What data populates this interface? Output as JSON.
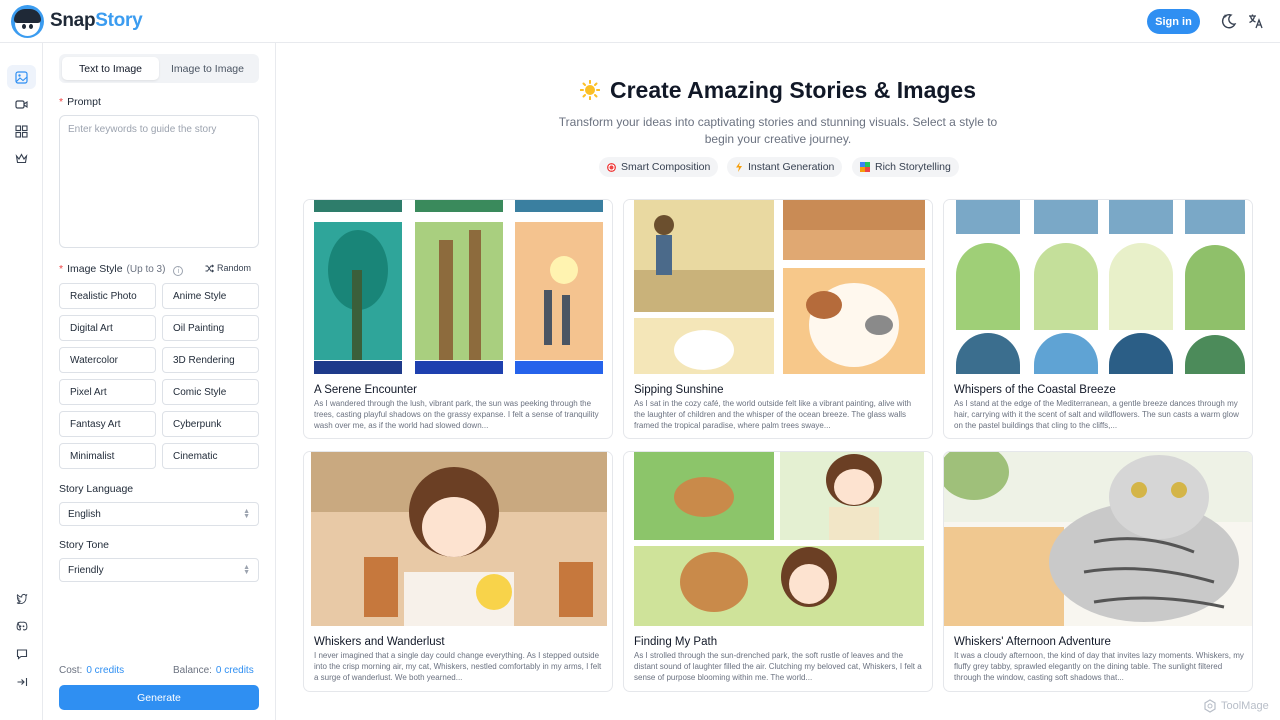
{
  "app": {
    "name_part1": "Snap",
    "name_part2": "Story"
  },
  "header": {
    "signin_label": "Sign in"
  },
  "panel": {
    "tabs": [
      "Text to Image",
      "Image to Image"
    ],
    "prompt_label": "Prompt",
    "prompt_placeholder": "Enter keywords to guide the story",
    "image_style_label": "Image Style",
    "image_style_hint": "(Up to 3)",
    "random_label": "Random",
    "styles": [
      "Realistic Photo",
      "Anime Style",
      "Digital Art",
      "Oil Painting",
      "Watercolor",
      "3D Rendering",
      "Pixel Art",
      "Comic Style",
      "Fantasy Art",
      "Cyberpunk",
      "Minimalist",
      "Cinematic"
    ],
    "language_label": "Story Language",
    "language_value": "English",
    "tone_label": "Story Tone",
    "tone_value": "Friendly",
    "cost_label": "Cost:",
    "cost_value": "0 credits",
    "balance_label": "Balance:",
    "balance_value": "0 credits",
    "generate_label": "Generate"
  },
  "main": {
    "title": "Create Amazing Stories & Images",
    "subtitle": "Transform your ideas into captivating stories and stunning visuals. Select a style to begin your creative journey.",
    "features": [
      "Smart Composition",
      "Instant Generation",
      "Rich Storytelling"
    ],
    "cards": [
      {
        "title": "A Serene Encounter",
        "text": "As I wandered through the lush, vibrant park, the sun was peeking through the trees, casting playful shadows on the grassy expanse. I felt a sense of tranquility wash over me, as if the world had slowed down..."
      },
      {
        "title": "Sipping Sunshine",
        "text": "As I sat in the cozy café, the world outside felt like a vibrant painting, alive with the laughter of children and the whisper of the ocean breeze. The glass walls framed the tropical paradise, where palm trees swaye..."
      },
      {
        "title": "Whispers of the Coastal Breeze",
        "text": "As I stand at the edge of the Mediterranean, a gentle breeze dances through my hair, carrying with it the scent of salt and wildflowers. The sun casts a warm glow on the pastel buildings that cling to the cliffs,..."
      },
      {
        "title": "Whiskers and Wanderlust",
        "text": "I never imagined that a single day could change everything. As I stepped outside into the crisp morning air, my cat, Whiskers, nestled comfortably in my arms, I felt a surge of wanderlust. We both yearned..."
      },
      {
        "title": "Finding My Path",
        "text": "As I strolled through the sun-drenched park, the soft rustle of leaves and the distant sound of laughter filled the air. Clutching my beloved cat, Whiskers, I felt a sense of purpose blooming within me. The world..."
      },
      {
        "title": "Whiskers' Afternoon Adventure",
        "text": "It was a cloudy afternoon, the kind of day that invites lazy moments. Whiskers, my fluffy grey tabby, sprawled elegantly on the dining table. The sunlight filtered through the window, casting soft shadows that..."
      }
    ]
  },
  "watermark": "ToolMage"
}
